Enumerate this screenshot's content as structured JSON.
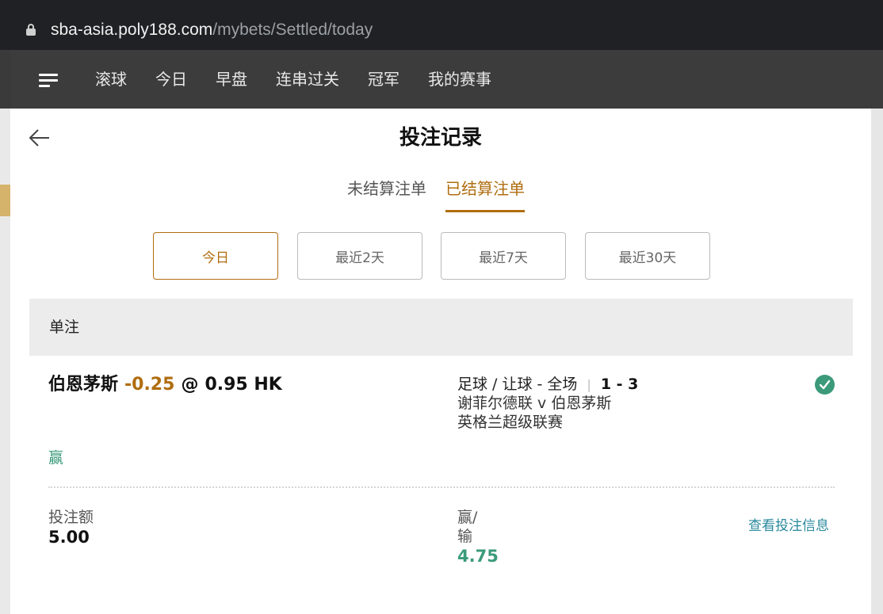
{
  "browser": {
    "url_host": "sba-asia.poly188.com",
    "url_path": "/mybets/Settled/today"
  },
  "topnav": {
    "items": [
      "滚球",
      "今日",
      "早盘",
      "连串过关",
      "冠军",
      "我的赛事"
    ]
  },
  "page": {
    "title": "投注记录",
    "tabs": [
      {
        "label": "未结算注单",
        "active": false
      },
      {
        "label": "已结算注单",
        "active": true
      }
    ],
    "filters": [
      {
        "label": "今日",
        "selected": true
      },
      {
        "label": "最近2天",
        "selected": false
      },
      {
        "label": "最近7天",
        "selected": false
      },
      {
        "label": "最近30天",
        "selected": false
      }
    ],
    "section_label": "单注"
  },
  "bet": {
    "team": "伯恩茅斯",
    "handicap": "-0.25",
    "at": "@",
    "odds": "0.95 HK",
    "market": "足球 / 让球 - 全场",
    "separator": "|",
    "score": "1 - 3",
    "match": "谢菲尔德联 v 伯恩茅斯",
    "league": "英格兰超级联赛",
    "result": "赢",
    "stake_label": "投注额",
    "stake_value": "5.00",
    "winloss_label": "赢/输",
    "winloss_value": "4.75",
    "view_link": "查看投注信息"
  },
  "colors": {
    "accent": "#b06d10",
    "win": "#3a9a7a",
    "link": "#2a8a9e",
    "nav_bg": "#3c3c3c"
  }
}
